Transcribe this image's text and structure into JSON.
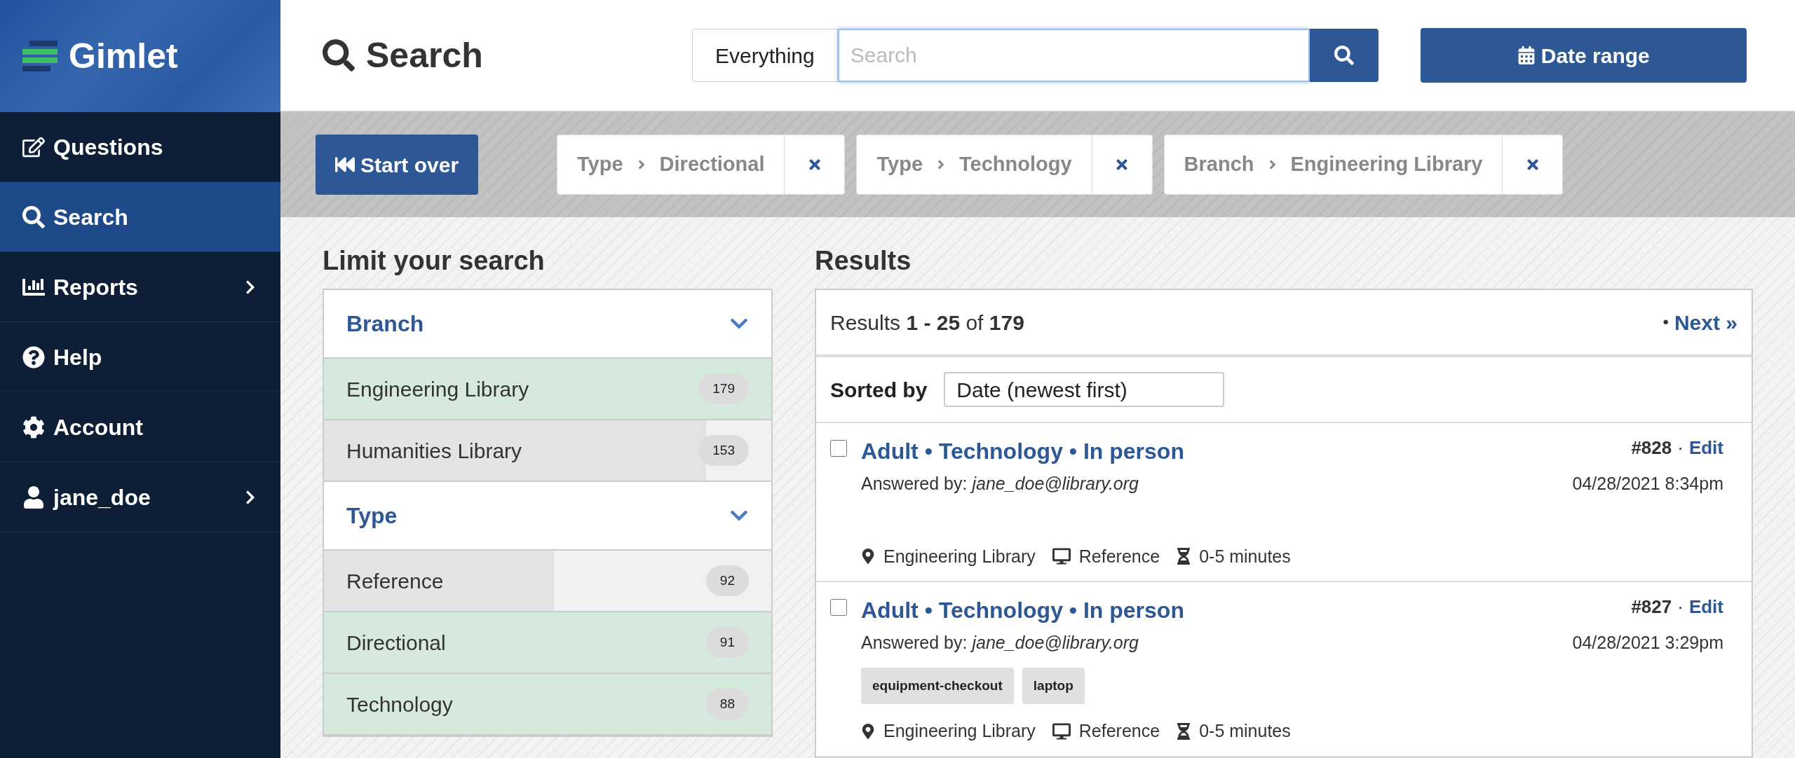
{
  "sidebar": {
    "brand": "Gimlet",
    "items": [
      {
        "label": "Questions",
        "selected": false,
        "submenu": false
      },
      {
        "label": "Search",
        "selected": true,
        "submenu": false
      },
      {
        "label": "Reports",
        "selected": false,
        "submenu": true
      },
      {
        "label": "Help",
        "selected": false,
        "submenu": false
      },
      {
        "label": "Account",
        "selected": false,
        "submenu": false
      },
      {
        "label": "jane_doe",
        "selected": false,
        "submenu": true
      }
    ]
  },
  "header": {
    "title": "Search",
    "scope": "Everything",
    "search": {
      "placeholder": "Search"
    },
    "date_button": "Date range"
  },
  "filters": {
    "start_over": "Start over",
    "chips": [
      {
        "field": "Type",
        "value": "Directional"
      },
      {
        "field": "Type",
        "value": "Technology"
      },
      {
        "field": "Branch",
        "value": "Engineering Library"
      }
    ]
  },
  "facets": {
    "title": "Limit your search",
    "groups": [
      {
        "title": "Branch",
        "expanded": true,
        "items": [
          {
            "label": "Engineering Library",
            "count": "179",
            "selected": true
          },
          {
            "label": "Humanities Library",
            "count": "153",
            "selected": false,
            "level": 0.855
          }
        ]
      },
      {
        "title": "Type",
        "expanded": true,
        "items": [
          {
            "label": "Reference",
            "count": "92",
            "selected": false,
            "level": 0.514
          },
          {
            "label": "Directional",
            "count": "91",
            "selected": true
          },
          {
            "label": "Technology",
            "count": "88",
            "selected": true
          }
        ]
      }
    ]
  },
  "results": {
    "title": "Results",
    "summary": "Results **1 - 25** of **179**",
    "next_sep": "•",
    "next": "Next »",
    "sort_label": "Sorted by",
    "sort_value": "Date (newest first)",
    "items": [
      {
        "checked": false,
        "title": "Adult • Technology • In person",
        "answered": "Answered by: *jane_doe@library.org*",
        "number": "#828",
        "sep": "·",
        "edit": "Edit",
        "date": "04/28/2021 8:34pm",
        "branch": "Engineering Library",
        "type": "Reference",
        "duration": "0-5 minutes"
      },
      {
        "checked": false,
        "title": "Adult • Technology • In person",
        "answered": "Answered by: *jane_doe@library.org*",
        "number": "#827",
        "sep": "·",
        "edit": "Edit",
        "date": "04/28/2021 3:29pm",
        "tags": [
          "equipment-checkout",
          "laptop"
        ],
        "branch": "Engineering Library",
        "type": "Reference",
        "duration": "0-5 minutes"
      }
    ]
  }
}
